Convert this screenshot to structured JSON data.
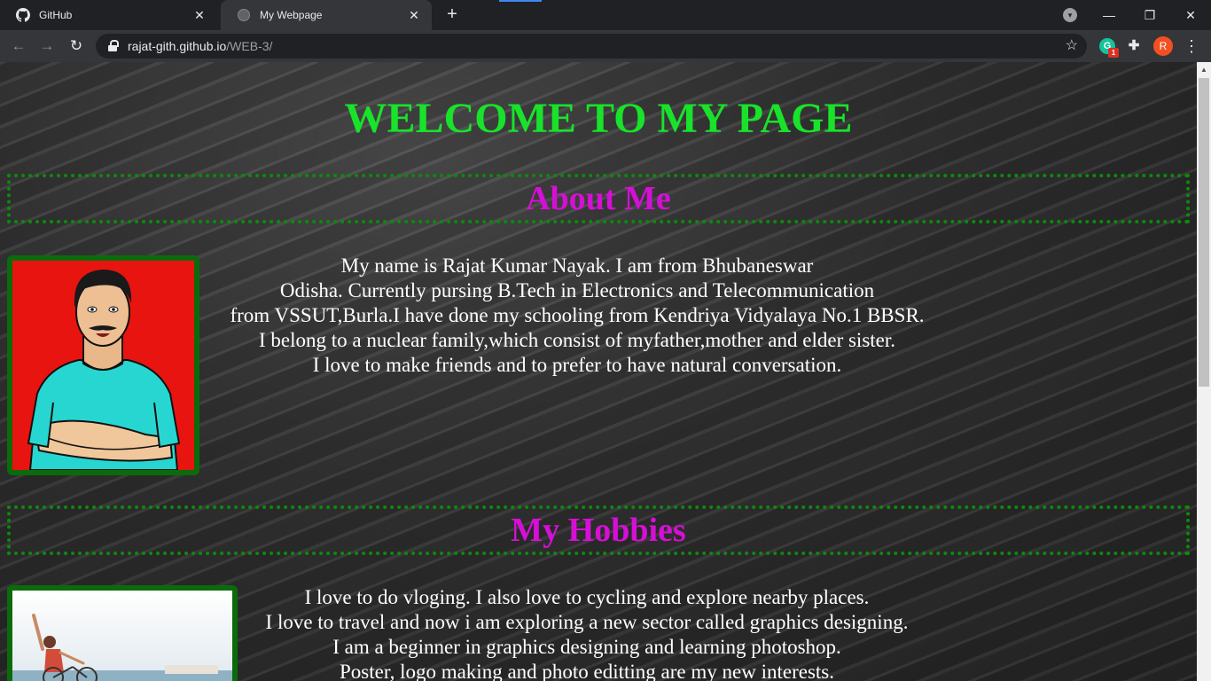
{
  "browser": {
    "tabs": [
      {
        "title": "GitHub",
        "icon": "github-icon",
        "active": false
      },
      {
        "title": "My Webpage",
        "icon": "globe-icon",
        "active": true
      }
    ],
    "url_host": "rajat-gith.github.io",
    "url_path": "/WEB-3/",
    "extension_badge": "1",
    "profile_initial": "R",
    "colors": {
      "chrome_dark": "#202124",
      "chrome_toolbar": "#35363a",
      "profile": "#f25022"
    }
  },
  "page": {
    "title": "WELCOME TO MY PAGE",
    "about": {
      "heading": "About Me",
      "lines": [
        "My name is Rajat Kumar Nayak. I am from Bhubaneswar",
        "Odisha. Currently pursing B.Tech in Electronics and Telecommunication",
        "from VSSUT,Burla.I have done my schooling from Kendriya Vidyalaya No.1 BBSR.",
        "I belong to a nuclear family,which consist of myfather,mother and elder sister.",
        "I love to make friends and to prefer to have natural conversation."
      ]
    },
    "hobbies": {
      "heading": "My Hobbies",
      "lines": [
        "I love to do vloging. I also love to cycling and explore nearby places.",
        "I love to travel and now i am exploring a new sector called graphics designing.",
        "I am a beginner in graphics designing and learning photoshop.",
        "Poster, logo making and photo editting are my new interests."
      ]
    },
    "colors": {
      "title": "#18e32a",
      "heading": "#d60fd6",
      "border": "#0c8a0c",
      "text": "#ffffff"
    }
  }
}
